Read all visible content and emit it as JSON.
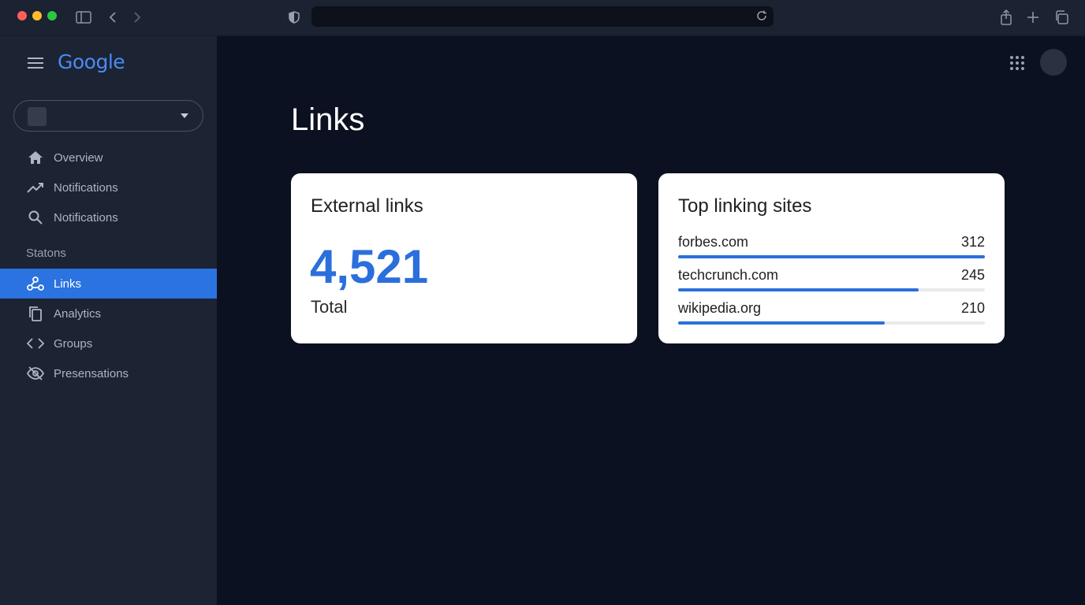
{
  "browser": {
    "url": ""
  },
  "sidebar": {
    "logo": "Google",
    "property_name": "",
    "items": [
      {
        "label": "Overview",
        "icon": "home-icon"
      },
      {
        "label": "Notifications",
        "icon": "trending-icon"
      },
      {
        "label": "Notifications",
        "icon": "search-icon"
      }
    ],
    "section_label": "Statons",
    "section_items": [
      {
        "label": "Links",
        "icon": "links-icon",
        "active": true
      },
      {
        "label": "Analytics",
        "icon": "copy-icon"
      },
      {
        "label": "Groups",
        "icon": "code-icon"
      },
      {
        "label": "Presensations",
        "icon": "eye-off-icon"
      }
    ]
  },
  "main": {
    "title": "Links",
    "external_links": {
      "title": "External links",
      "value": "4,521",
      "caption": "Total"
    },
    "top_sites": {
      "title": "Top linking sites",
      "rows": [
        {
          "site": "forbes.com",
          "count": "312",
          "fraction": 1.0
        },
        {
          "site": "techcrunch.com",
          "count": "245",
          "fraction": 0.785
        },
        {
          "site": "wikipedia.org",
          "count": "210",
          "fraction": 0.673
        }
      ]
    }
  },
  "colors": {
    "accent": "#2a73e0",
    "number_blue": "#2a6fdb",
    "logo": "#4a8af4"
  }
}
